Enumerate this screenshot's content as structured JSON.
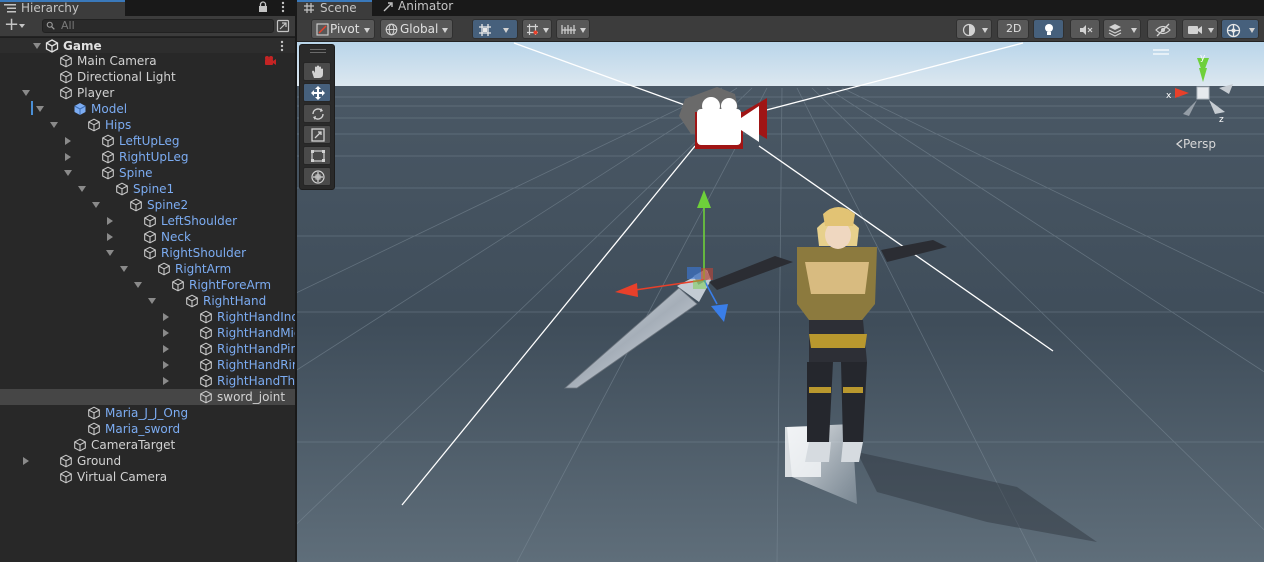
{
  "hierarchy": {
    "tab_label": "Hierarchy",
    "search_placeholder": "All",
    "add_label": "+",
    "rows": [
      {
        "label": "Game",
        "depth": 0,
        "arrow": "open",
        "bold": true,
        "blue": false,
        "icon": "unity-scene-icon"
      },
      {
        "label": "Main Camera",
        "depth": 1,
        "arrow": "none",
        "bold": false,
        "blue": false,
        "icon": "gameobject-icon",
        "warning": true
      },
      {
        "label": "Directional Light",
        "depth": 1,
        "arrow": "none",
        "bold": false,
        "blue": false,
        "icon": "gameobject-icon"
      },
      {
        "label": "Player",
        "depth": 1,
        "arrow": "open",
        "bold": false,
        "blue": false,
        "icon": "gameobject-icon"
      },
      {
        "label": "Model",
        "depth": 2,
        "arrow": "open",
        "bold": false,
        "blue": true,
        "icon": "prefab-icon"
      },
      {
        "label": "Hips",
        "depth": 3,
        "arrow": "open",
        "bold": false,
        "blue": true,
        "icon": "gameobject-icon"
      },
      {
        "label": "LeftUpLeg",
        "depth": 4,
        "arrow": "closed",
        "bold": false,
        "blue": true,
        "icon": "gameobject-icon"
      },
      {
        "label": "RightUpLeg",
        "depth": 4,
        "arrow": "closed",
        "bold": false,
        "blue": true,
        "icon": "gameobject-icon"
      },
      {
        "label": "Spine",
        "depth": 4,
        "arrow": "open",
        "bold": false,
        "blue": true,
        "icon": "gameobject-icon"
      },
      {
        "label": "Spine1",
        "depth": 5,
        "arrow": "open",
        "bold": false,
        "blue": true,
        "icon": "gameobject-icon"
      },
      {
        "label": "Spine2",
        "depth": 6,
        "arrow": "open",
        "bold": false,
        "blue": true,
        "icon": "gameobject-icon"
      },
      {
        "label": "LeftShoulder",
        "depth": 7,
        "arrow": "closed",
        "bold": false,
        "blue": true,
        "icon": "gameobject-icon"
      },
      {
        "label": "Neck",
        "depth": 7,
        "arrow": "closed",
        "bold": false,
        "blue": true,
        "icon": "gameobject-icon"
      },
      {
        "label": "RightShoulder",
        "depth": 7,
        "arrow": "open",
        "bold": false,
        "blue": true,
        "icon": "gameobject-icon"
      },
      {
        "label": "RightArm",
        "depth": 8,
        "arrow": "open",
        "bold": false,
        "blue": true,
        "icon": "gameobject-icon"
      },
      {
        "label": "RightForeArm",
        "depth": 9,
        "arrow": "open",
        "bold": false,
        "blue": true,
        "icon": "gameobject-icon"
      },
      {
        "label": "RightHand",
        "depth": 10,
        "arrow": "open",
        "bold": false,
        "blue": true,
        "icon": "gameobject-icon"
      },
      {
        "label": "RightHandInd",
        "depth": 11,
        "arrow": "closed",
        "bold": false,
        "blue": true,
        "icon": "gameobject-icon"
      },
      {
        "label": "RightHandMic",
        "depth": 11,
        "arrow": "closed",
        "bold": false,
        "blue": true,
        "icon": "gameobject-icon"
      },
      {
        "label": "RightHandPin",
        "depth": 11,
        "arrow": "closed",
        "bold": false,
        "blue": true,
        "icon": "gameobject-icon"
      },
      {
        "label": "RightHandRin",
        "depth": 11,
        "arrow": "closed",
        "bold": false,
        "blue": true,
        "icon": "gameobject-icon"
      },
      {
        "label": "RightHandThu",
        "depth": 11,
        "arrow": "closed",
        "bold": false,
        "blue": true,
        "icon": "gameobject-icon"
      },
      {
        "label": "sword_joint",
        "depth": 11,
        "arrow": "none",
        "bold": false,
        "blue": false,
        "icon": "gameobject-icon",
        "selected": true
      },
      {
        "label": "Maria_J_J_Ong",
        "depth": 3,
        "arrow": "none",
        "bold": false,
        "blue": true,
        "icon": "gameobject-icon"
      },
      {
        "label": "Maria_sword",
        "depth": 3,
        "arrow": "none",
        "bold": false,
        "blue": true,
        "icon": "gameobject-icon"
      },
      {
        "label": "CameraTarget",
        "depth": 2,
        "arrow": "none",
        "bold": false,
        "blue": false,
        "icon": "gameobject-icon"
      },
      {
        "label": "Ground",
        "depth": 1,
        "arrow": "closed",
        "bold": false,
        "blue": false,
        "icon": "gameobject-icon"
      },
      {
        "label": "Virtual Camera",
        "depth": 1,
        "arrow": "none",
        "bold": false,
        "blue": false,
        "icon": "gameobject-icon"
      }
    ]
  },
  "scene": {
    "tabs": [
      "Scene",
      "Animator"
    ],
    "toolbar": {
      "pivot_label": "Pivot",
      "global_label": "Global",
      "mode_2d_label": "2D"
    },
    "persp_label": "Persp",
    "gizmo_axes": {
      "x": "x",
      "y": "y",
      "z": "z"
    }
  },
  "colors": {
    "accent": "#3a79bb",
    "blue_text": "#7cacf2",
    "axis_x": "#e8402a",
    "axis_y": "#6ed03a",
    "axis_z": "#3a7ee8"
  }
}
